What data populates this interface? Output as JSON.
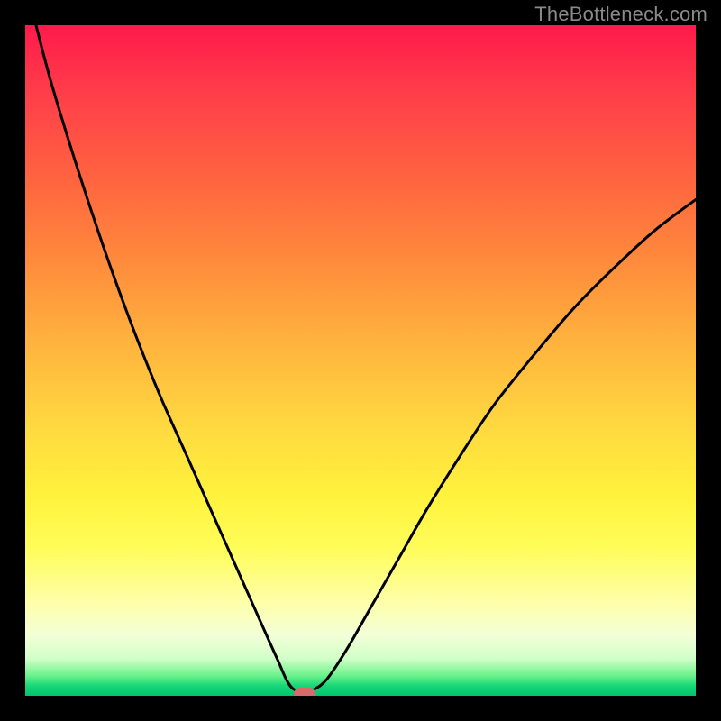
{
  "watermark": "TheBottleneck.com",
  "colors": {
    "background": "#000000",
    "curve": "#000000",
    "marker": "#d86a6a"
  },
  "chart_data": {
    "type": "line",
    "title": "",
    "xlabel": "",
    "ylabel": "",
    "xlim": [
      0,
      100
    ],
    "ylim": [
      0,
      100
    ],
    "grid": false,
    "legend": false,
    "series": [
      {
        "name": "bottleneck-curve",
        "x": [
          1.6,
          4,
          8,
          12,
          16,
          20,
          24,
          28,
          32,
          34,
          36,
          37.8,
          39,
          40,
          41.5,
          43,
          45,
          48,
          52,
          56,
          60,
          65,
          70,
          76,
          82,
          88,
          94,
          100
        ],
        "values": [
          100,
          91,
          78,
          66,
          55,
          45,
          36,
          27,
          18,
          13.5,
          9,
          5,
          2.3,
          1.0,
          0.5,
          0.9,
          2.5,
          7,
          14,
          21,
          28,
          36,
          43.5,
          51,
          58,
          64,
          69.5,
          74
        ]
      }
    ],
    "marker": {
      "x": 41.7,
      "y": 0.3
    },
    "gradient_stops": [
      {
        "pos": 0.0,
        "color": "#ff1a4b"
      },
      {
        "pos": 0.35,
        "color": "#ff8a3c"
      },
      {
        "pos": 0.7,
        "color": "#fff23c"
      },
      {
        "pos": 0.95,
        "color": "#6bf28a"
      },
      {
        "pos": 1.0,
        "color": "#00c36e"
      }
    ]
  }
}
